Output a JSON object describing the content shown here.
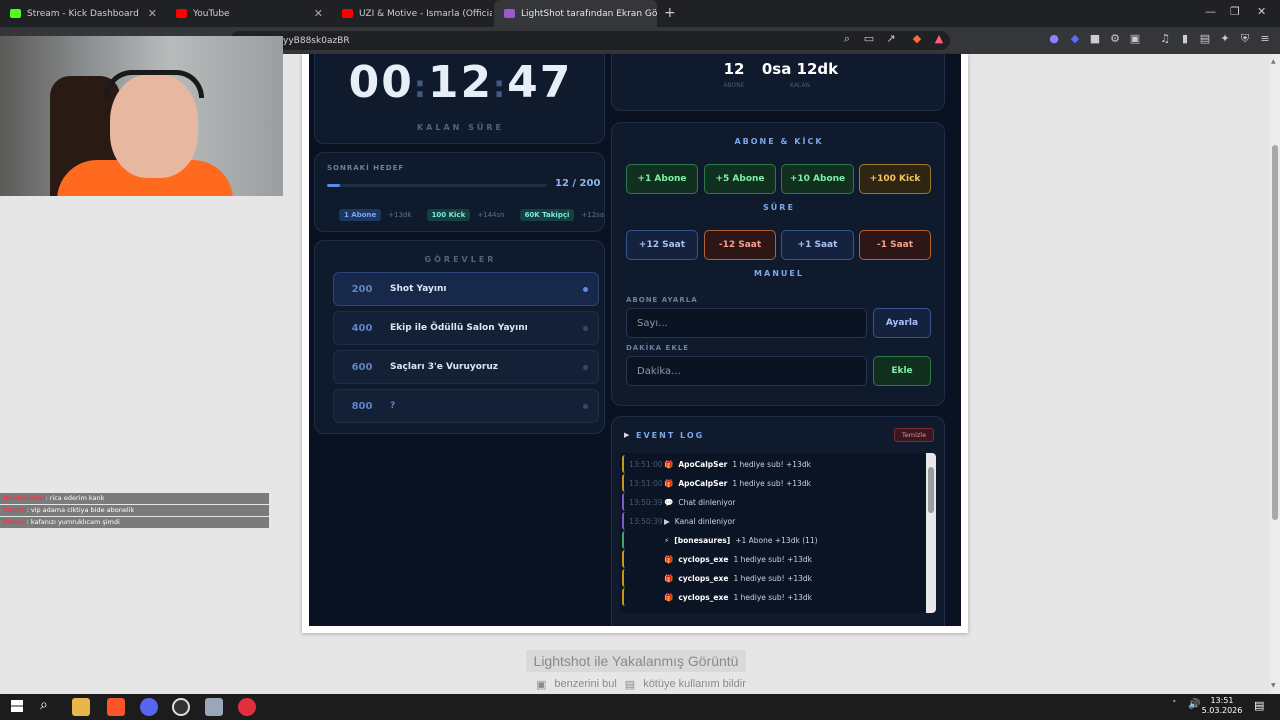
{
  "browser": {
    "tabs": [
      {
        "label": "Stream - Kick Dashboard",
        "color": "#53fc18"
      },
      {
        "label": "YouTube",
        "color": "#ff0000"
      },
      {
        "label": "UZI & Motive - Ismarla (Official V",
        "color": "#ff0000"
      },
      {
        "label": "LightShot tarafından Ekran Görün",
        "color": "#9b59d0"
      }
    ],
    "url": "/yyB88sk0azBR"
  },
  "page": {
    "footer_title": "Lightshot ile Yakalanmış Görüntü",
    "link_similar": "benzerini bul",
    "link_report": "kötüye kullanım bildir"
  },
  "timer": {
    "hh": "00",
    "mm": "12",
    "ss": "47",
    "label": "KALAN SÜRE"
  },
  "stats": {
    "subs_value": "12",
    "subs_label": "ABONE",
    "remain_value": "0sa 12dk",
    "remain_label": "KALAN"
  },
  "next_goal": {
    "label": "SONRAKİ HEDEF",
    "progress": "12 / 200",
    "fraction": 0.06,
    "chips": [
      {
        "tag": "1 Abone",
        "value": "+13dk"
      },
      {
        "tag": "100 Kick",
        "value": "+144sn"
      },
      {
        "tag": "60K Takipçi",
        "value": "+12sa"
      }
    ]
  },
  "tasks": {
    "title": "GÖREVLER",
    "items": [
      {
        "num": "200",
        "text": "Shot Yayını"
      },
      {
        "num": "400",
        "text": "Ekip ile Ödüllü Salon Yayını"
      },
      {
        "num": "600",
        "text": "Saçları 3'e Vuruyoruz"
      },
      {
        "num": "800",
        "text": "?"
      }
    ]
  },
  "controls": {
    "sub_kick_title": "ABONE & KİCK",
    "sub_buttons": [
      "+1 Abone",
      "+5 Abone",
      "+10 Abone",
      "+100 Kick"
    ],
    "time_title": "SÜRE",
    "time_buttons": [
      "+12 Saat",
      "-12 Saat",
      "+1 Saat",
      "-1 Saat"
    ],
    "manual_title": "MANUEL",
    "set_subs_label": "ABONE AYARLA",
    "set_subs_placeholder": "Sayı...",
    "set_subs_button": "Ayarla",
    "add_min_label": "DAKİKA EKLE",
    "add_min_placeholder": "Dakika...",
    "add_min_button": "Ekle"
  },
  "event_log": {
    "title": "EVENT LOG",
    "clear": "Temizle",
    "rows": [
      {
        "time": "13:51:00",
        "icon": "🎁",
        "user": "ApoCalpSer",
        "text": "1 hediye sub! +13dk"
      },
      {
        "time": "13:51:00",
        "icon": "🎁",
        "user": "ApoCalpSer",
        "text": "1 hediye sub! +13dk"
      },
      {
        "time": "13:50:39",
        "icon": "💬",
        "user": "",
        "text": "Chat dinleniyor"
      },
      {
        "time": "13:50:39",
        "icon": "▶",
        "user": "",
        "text": "Kanal dinleniyor"
      },
      {
        "time": "",
        "icon": "⚡",
        "user": "[bonesaures]",
        "text": "+1 Abone +13dk (11)"
      },
      {
        "time": "",
        "icon": "🎁",
        "user": "cyclops_exe",
        "text": "1 hediye sub! +13dk"
      },
      {
        "time": "",
        "icon": "🎁",
        "user": "cyclops_exe",
        "text": "1 hediye sub! +13dk"
      },
      {
        "time": "",
        "icon": "🎁",
        "user": "cyclops_exe",
        "text": "1 hediye sub! +13dk"
      }
    ]
  },
  "overlay_chat": [
    {
      "user": "ApoCalpSer",
      "text": ": rica ederim kank"
    },
    {
      "user": "Zanrei",
      "text": ": vip adama ciktiya bide abonelik"
    },
    {
      "user": "Zanrei",
      "text": ": kafanızı yumruklıcam şimdi"
    }
  ],
  "taskbar": {
    "time": "13:51",
    "date": "5.03.2026"
  },
  "colors": {
    "accent": "#5b8def",
    "green": "#7ff0a8",
    "gold": "#f4c462",
    "red": "#f5a08a",
    "dark": "#0a1120"
  }
}
